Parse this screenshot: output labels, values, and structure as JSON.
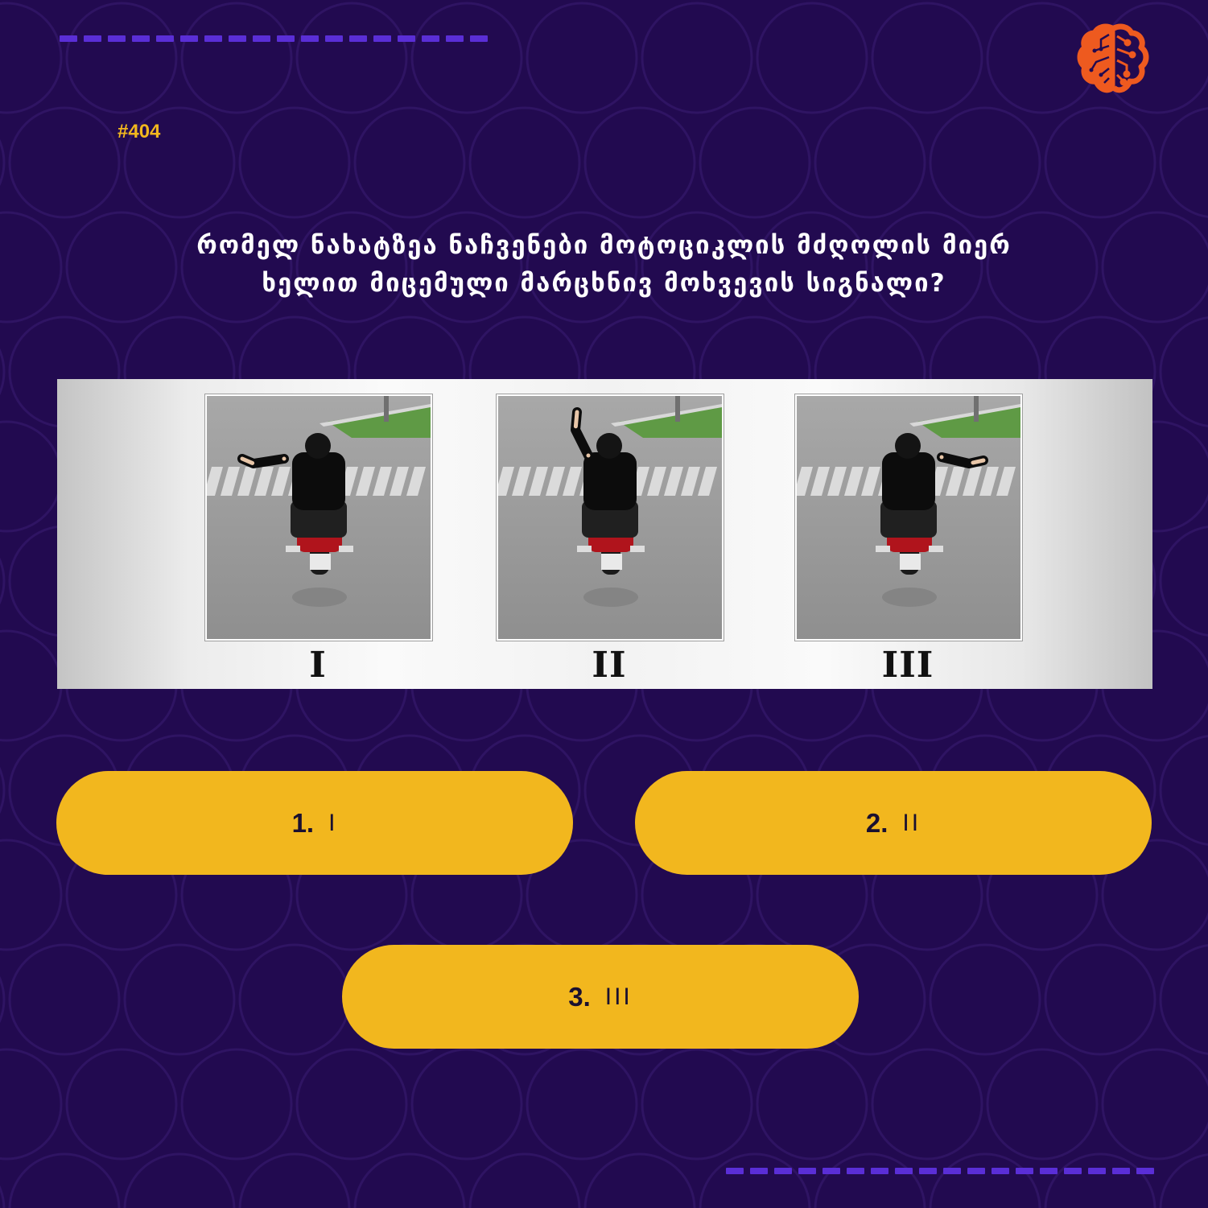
{
  "question_number": "#404",
  "question_lines": [
    "რომელ ნახატზეა ნაჩვენები მოტოციკლის მძღოლის მიერ",
    "ხელით მიცემული მარცხნივ მოხვევის სიგნალი?"
  ],
  "figure": {
    "labels": [
      "I",
      "II",
      "III"
    ]
  },
  "options": [
    {
      "number": "1.",
      "value": "I"
    },
    {
      "number": "2.",
      "value": "II"
    },
    {
      "number": "3.",
      "value": "III"
    }
  ],
  "colors": {
    "background": "#220a50",
    "accent": "#f2b71e",
    "dash": "#5a2ed6",
    "logo": "#ee5a1f"
  }
}
